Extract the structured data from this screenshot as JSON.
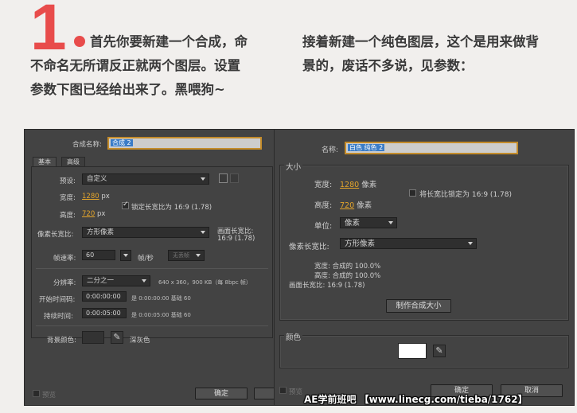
{
  "step_number": "1",
  "article": {
    "left_line1": "首先你要新建一个合成，命",
    "left_line2": "不命名无所谓反正就两个图层。设置",
    "left_line3": "参数下图已经给出来了。黑喂狗~",
    "right_line1": "接着新建一个纯色图层，这个是用来做背",
    "right_line2": "景的，废话不多说，见参数："
  },
  "comp_dialog": {
    "name_label": "合成名称:",
    "name_value": "合成 2",
    "tabs": [
      "基本",
      "高级"
    ],
    "preset_label": "预设:",
    "preset_value": "自定义",
    "width_label": "宽度:",
    "width_value": "1280",
    "width_unit": "px",
    "height_label": "高度:",
    "height_value": "720",
    "height_unit": "px",
    "lock_ratio_label": "锁定长宽比为 16:9 (1.78)",
    "lock_ratio_checked": true,
    "pixel_aspect_label": "像素长宽比:",
    "pixel_aspect_value": "方形像素",
    "frame_aspect_label": "画面长宽比:",
    "frame_aspect_value": "16:9 (1.78)",
    "framerate_label": "帧速率:",
    "framerate_value": "60",
    "framerate_unit": "帧/秒",
    "drop_frame_value": "无丢帧",
    "resolution_label": "分辨率:",
    "resolution_value": "二分之一",
    "resolution_info": "640 x 360，900 KB（每 8bpc 帧）",
    "start_tc_label": "开始时间码:",
    "start_tc_value": "0:00:00:00",
    "start_tc_info": "是 0:00:00:00  基础 60",
    "duration_label": "持续时间:",
    "duration_value": "0:00:05:00",
    "duration_info": "是 0:00:05:00  基础 60",
    "bg_color_label": "背景颜色:",
    "bg_color_name": "深灰色",
    "preview_label": "预览",
    "ok_label": "确定"
  },
  "solid_dialog": {
    "name_label": "名称:",
    "name_value": "白色 纯色 2",
    "size_group_label": "大小",
    "width_label": "宽度:",
    "width_value": "1280",
    "width_unit": "像素",
    "height_label": "高度:",
    "height_value": "720",
    "height_unit": "像素",
    "lock_ratio_label": "将长宽比锁定为 16:9 (1.78)",
    "lock_ratio_checked": false,
    "units_label": "单位:",
    "units_value": "像素",
    "pixel_aspect_label": "像素长宽比:",
    "pixel_aspect_value": "方形像素",
    "info_width": "宽度: 合成的 100.0%",
    "info_height": "高度: 合成的 100.0%",
    "info_frame_aspect": "画面长宽比: 16:9 (1.78)",
    "make_comp_size_label": "制作合成大小",
    "color_group_label": "颜色",
    "preview_label": "预览",
    "ok_label": "确定",
    "cancel_label": "取消"
  },
  "watermark_text": "AE学前班吧 【www.linecg.com/tieba/1762】",
  "colors": {
    "accent_red": "#e84c4b",
    "dialog_bg": "#434343",
    "highlight": "#c48c2b",
    "bg_swatch": "#333333",
    "solid_swatch": "#ffffff"
  }
}
